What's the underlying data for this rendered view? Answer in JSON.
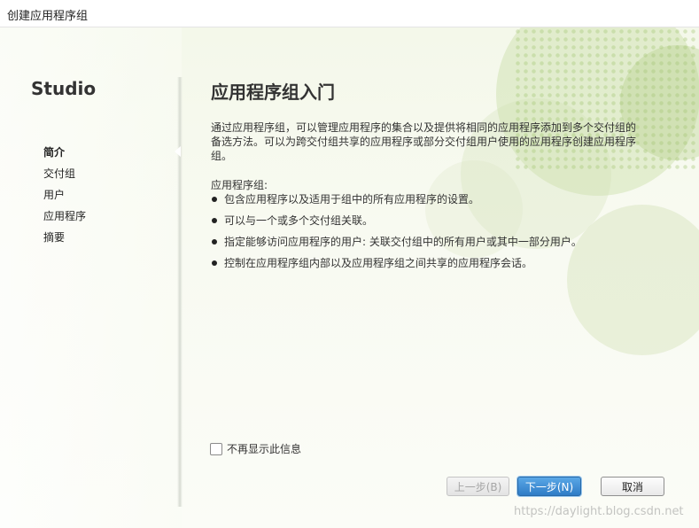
{
  "window": {
    "title": "创建应用程序组"
  },
  "sidebar": {
    "brand": "Studio",
    "items": [
      {
        "label": "简介",
        "active": true
      },
      {
        "label": "交付组",
        "active": false
      },
      {
        "label": "用户",
        "active": false
      },
      {
        "label": "应用程序",
        "active": false
      },
      {
        "label": "摘要",
        "active": false
      }
    ]
  },
  "main": {
    "title": "应用程序组入门",
    "intro": "通过应用程序组，可以管理应用程序的集合以及提供将相同的应用程序添加到多个交付组的备选方法。可以为跨交付组共享的应用程序或部分交付组用户使用的应用程序创建应用程序组。",
    "group_label": "应用程序组:",
    "bullets": [
      "包含应用程序以及适用于组中的所有应用程序的设置。",
      "可以与一个或多个交付组关联。",
      "指定能够访问应用程序的用户: 关联交付组中的所有用户或其中一部分用户。",
      "控制在应用程序组内部以及应用程序组之间共享的应用程序会话。"
    ]
  },
  "options": {
    "dont_show_again_label": "不再显示此信息",
    "dont_show_again_checked": false
  },
  "buttons": {
    "prev_label": "上一步(B)",
    "next_label": "下一步(N)",
    "cancel_label": "取消"
  },
  "watermark": "https://daylight.blog.csdn.net",
  "colors": {
    "accent": "#2f7cc6",
    "background": "#f4f8ea",
    "decor": "#bed696"
  }
}
